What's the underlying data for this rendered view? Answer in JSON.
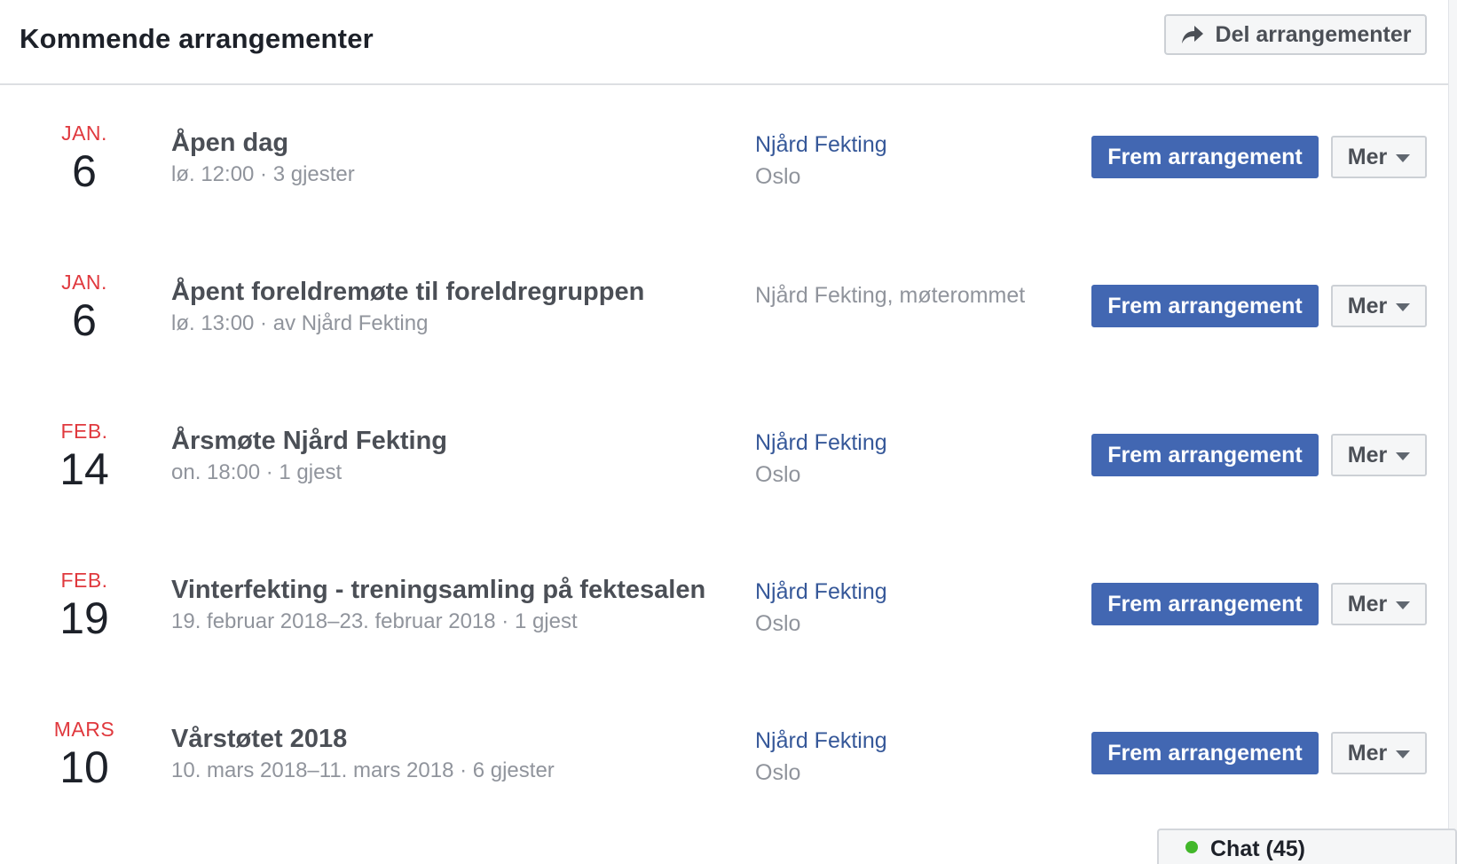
{
  "header": {
    "title": "Kommende arrangementer",
    "share_label": "Del arrangementer"
  },
  "events": [
    {
      "month": "JAN.",
      "day": "6",
      "title": "Åpen dag",
      "meta": "lø. 12:00 · 3 gjester",
      "location_link": "Njård Fekting",
      "location_city": "Oslo",
      "location_plain": "",
      "boost_label": "Frem arrangement",
      "more_label": "Mer"
    },
    {
      "month": "JAN.",
      "day": "6",
      "title": "Åpent foreldremøte til foreldregruppen",
      "meta": "lø. 13:00 · av Njård Fekting",
      "location_link": "",
      "location_city": "",
      "location_plain": "Njård Fekting, møterommet",
      "boost_label": "Frem arrangement",
      "more_label": "Mer"
    },
    {
      "month": "FEB.",
      "day": "14",
      "title": "Årsmøte Njård Fekting",
      "meta": "on. 18:00 · 1 gjest",
      "location_link": "Njård Fekting",
      "location_city": "Oslo",
      "location_plain": "",
      "boost_label": "Frem arrangement",
      "more_label": "Mer"
    },
    {
      "month": "FEB.",
      "day": "19",
      "title": "Vinterfekting - treningsamling på fektesalen",
      "meta": "19. februar 2018–23. februar 2018 · 1 gjest",
      "location_link": "Njård Fekting",
      "location_city": "Oslo",
      "location_plain": "",
      "boost_label": "Frem arrangement",
      "more_label": "Mer"
    },
    {
      "month": "MARS",
      "day": "10",
      "title": "Vårstøtet 2018",
      "meta": "10. mars 2018–11. mars 2018 · 6 gjester",
      "location_link": "Njård Fekting",
      "location_city": "Oslo",
      "location_plain": "",
      "boost_label": "Frem arrangement",
      "more_label": "Mer"
    }
  ],
  "chat": {
    "label": "Chat (45)",
    "status_color": "#42b72a"
  },
  "colors": {
    "accent": "#4267b2",
    "month": "#e0393e",
    "link": "#365899",
    "muted": "#90949c"
  },
  "icons": {
    "share": "share-arrow-icon",
    "caret": "chevron-down-icon",
    "online": "online-dot-icon"
  }
}
